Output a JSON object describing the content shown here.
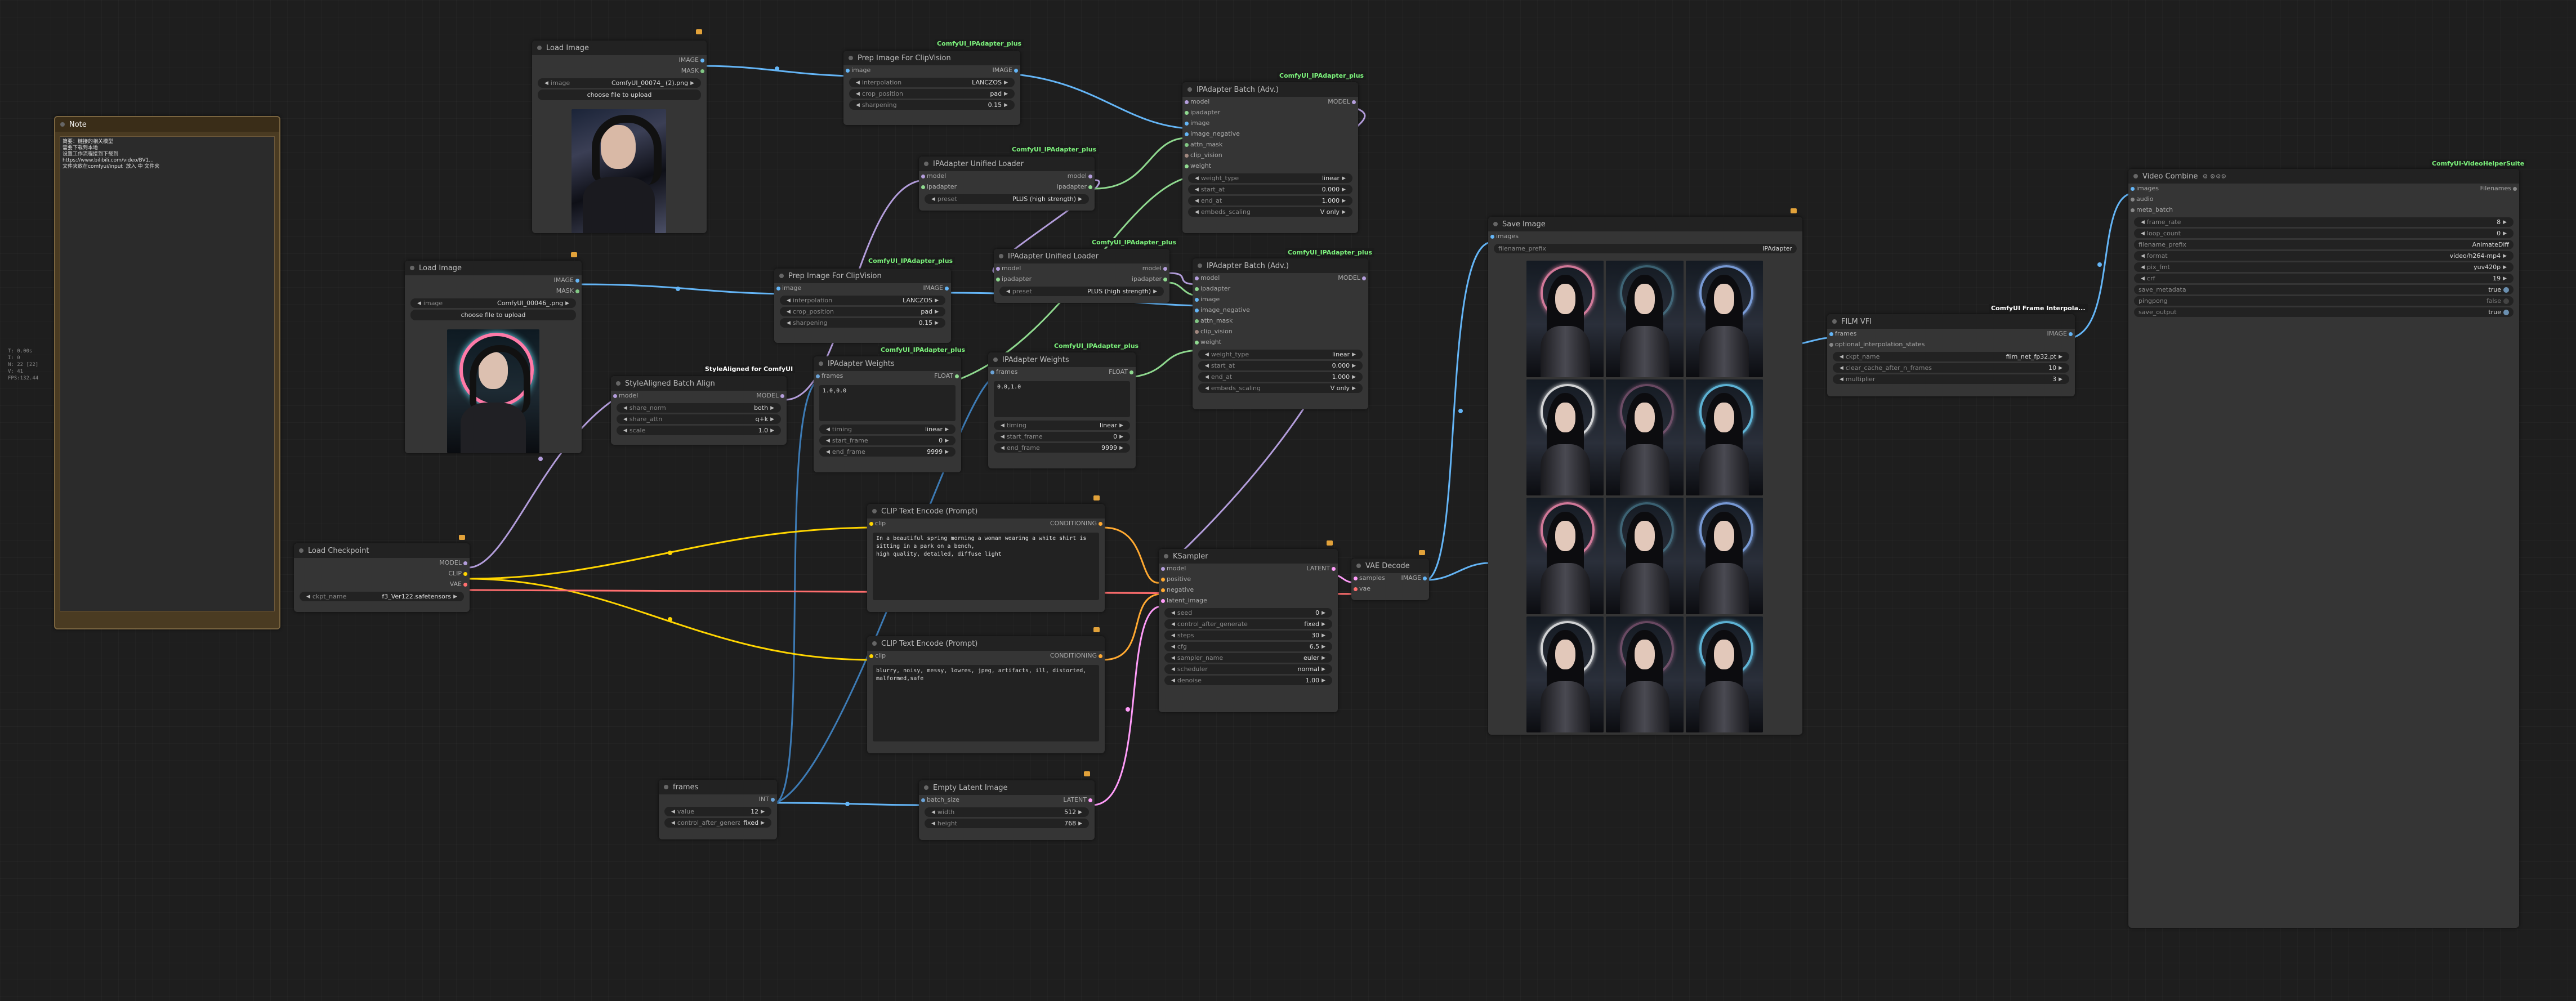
{
  "readout": [
    "T: 0.00s",
    "I: 0",
    "N: 22 [22]",
    "V: 41",
    "FPS:132.44"
  ],
  "note": {
    "title": "Note",
    "text": "简要：链接的相关模型\n需要下载到本地\n设置工作流程接到下载到\nhttps://www.bilibili.com/video/BV1...\n文件夹放在comfyui/input  放入 中 文件夹"
  },
  "nodes": {
    "load_image_1": {
      "title": "Load Image",
      "outputs": [
        "IMAGE",
        "MASK"
      ],
      "image": "ComfyUI_00074_ (2).png",
      "upload": "choose file to upload",
      "image_label": "image"
    },
    "load_image_2": {
      "title": "Load Image",
      "outputs": [
        "IMAGE",
        "MASK"
      ],
      "image": "ComfyUI_00046_.png",
      "upload": "choose file to upload",
      "image_label": "image"
    },
    "prep_1": {
      "title": "Prep Image For ClipVision",
      "tag": "ComfyUI_IPAdapter_plus",
      "input": "image",
      "output": "IMAGE",
      "widgets": [
        [
          "interpolation",
          "LANCZOS"
        ],
        [
          "crop_position",
          "pad"
        ],
        [
          "sharpening",
          "0.15"
        ]
      ]
    },
    "prep_2": {
      "title": "Prep Image For ClipVision",
      "tag": "ComfyUI_IPAdapter_plus",
      "input": "image",
      "output": "IMAGE",
      "widgets": [
        [
          "interpolation",
          "LANCZOS"
        ],
        [
          "crop_position",
          "pad"
        ],
        [
          "sharpening",
          "0.15"
        ]
      ]
    },
    "unified_1": {
      "title": "IPAdapter Unified Loader",
      "tag": "ComfyUI_IPAdapter_plus",
      "inputs": [
        "model",
        "ipadapter"
      ],
      "outputs": [
        "model",
        "ipadapter"
      ],
      "widgets": [
        [
          "preset",
          "PLUS (high strength)"
        ]
      ]
    },
    "unified_2": {
      "title": "IPAdapter Unified Loader",
      "tag": "ComfyUI_IPAdapter_plus",
      "inputs": [
        "model",
        "ipadapter"
      ],
      "outputs": [
        "model",
        "ipadapter"
      ],
      "widgets": [
        [
          "preset",
          "PLUS (high strength)"
        ]
      ]
    },
    "batch_1": {
      "title": "IPAdapter Batch (Adv.)",
      "tag": "ComfyUI_IPAdapter_plus",
      "output": "MODEL",
      "inputs": [
        "model",
        "ipadapter",
        "image",
        "image_negative",
        "attn_mask",
        "clip_vision",
        "weight"
      ],
      "widgets": [
        [
          "weight_type",
          "linear"
        ],
        [
          "start_at",
          "0.000"
        ],
        [
          "end_at",
          "1.000"
        ],
        [
          "embeds_scaling",
          "V only"
        ]
      ]
    },
    "batch_2": {
      "title": "IPAdapter Batch (Adv.)",
      "tag": "ComfyUI_IPAdapter_plus",
      "output": "MODEL",
      "inputs": [
        "model",
        "ipadapter",
        "image",
        "image_negative",
        "attn_mask",
        "clip_vision",
        "weight"
      ],
      "widgets": [
        [
          "weight_type",
          "linear"
        ],
        [
          "start_at",
          "0.000"
        ],
        [
          "end_at",
          "1.000"
        ],
        [
          "embeds_scaling",
          "V only"
        ]
      ]
    },
    "weights_1": {
      "title": "IPAdapter Weights",
      "tag": "ComfyUI_IPAdapter_plus",
      "input": "frames",
      "output": "FLOAT",
      "text": "1.0,0.0",
      "widgets": [
        [
          "timing",
          "linear"
        ],
        [
          "start_frame",
          "0"
        ],
        [
          "end_frame",
          "9999"
        ]
      ]
    },
    "weights_2": {
      "title": "IPAdapter Weights",
      "tag": "ComfyUI_IPAdapter_plus",
      "input": "frames",
      "output": "FLOAT",
      "text": "0.0,1.0",
      "widgets": [
        [
          "timing",
          "linear"
        ],
        [
          "start_frame",
          "0"
        ],
        [
          "end_frame",
          "9999"
        ]
      ]
    },
    "style": {
      "title": "StyleAligned Batch Align",
      "tag": "StyleAligned for ComfyUI",
      "input": "model",
      "output": "MODEL",
      "widgets": [
        [
          "share_norm",
          "both"
        ],
        [
          "share_attn",
          "q+k"
        ],
        [
          "scale",
          "1.0"
        ]
      ]
    },
    "checkpoint": {
      "title": "Load Checkpoint",
      "outputs": [
        "MODEL",
        "CLIP",
        "VAE"
      ],
      "widgets": [
        [
          "ckpt_name",
          "f3_Ver122.safetensors"
        ]
      ]
    },
    "clip_pos": {
      "title": "CLIP Text Encode (Prompt)",
      "input": "clip",
      "output": "CONDITIONING",
      "text": "In a beautiful spring morning a woman wearing a white shirt is sitting in a park on a bench,\nhigh quality, detailed, diffuse light"
    },
    "clip_neg": {
      "title": "CLIP Text Encode (Prompt)",
      "input": "clip",
      "output": "CONDITIONING",
      "text": "blurry, noisy, messy, lowres, jpeg, artifacts, ill, distorted, malformed,safe"
    },
    "frames": {
      "title": "frames",
      "output": "INT",
      "widgets": [
        [
          "value",
          "12"
        ],
        [
          "control_after_generate",
          "fixed"
        ]
      ]
    },
    "latent": {
      "title": "Empty Latent Image",
      "input": "batch_size",
      "output": "LATENT",
      "widgets": [
        [
          "width",
          "512"
        ],
        [
          "height",
          "768"
        ]
      ]
    },
    "ksampler": {
      "title": "KSampler",
      "output": "LATENT",
      "inputs": [
        "model",
        "positive",
        "negative",
        "latent_image"
      ],
      "widgets": [
        [
          "seed",
          "0"
        ],
        [
          "control_after_generate",
          "fixed"
        ],
        [
          "steps",
          "30"
        ],
        [
          "cfg",
          "6.5"
        ],
        [
          "sampler_name",
          "euler"
        ],
        [
          "scheduler",
          "normal"
        ],
        [
          "denoise",
          "1.00"
        ]
      ]
    },
    "vae_decode": {
      "title": "VAE Decode",
      "inputs": [
        "samples",
        "vae"
      ],
      "output": "IMAGE"
    },
    "save": {
      "title": "Save Image",
      "input": "images",
      "widgets": [
        [
          "filename_prefix",
          "IPAdapter"
        ]
      ]
    },
    "film": {
      "title": "FILM VFI",
      "tag": "ComfyUI Frame Interpola...",
      "inputs": [
        "frames",
        "optional_interpolation_states"
      ],
      "output": "IMAGE",
      "widgets": [
        [
          "ckpt_name",
          "film_net_fp32.pt"
        ],
        [
          "clear_cache_after_n_frames",
          "10"
        ],
        [
          "multiplier",
          "3"
        ]
      ]
    },
    "video": {
      "title": "Video Combine",
      "tag": "ComfyUI-VideoHelperSuite",
      "inputs": [
        "images",
        "audio",
        "meta_batch"
      ],
      "output": "Filenames",
      "widgets": [
        [
          "frame_rate",
          "8"
        ],
        [
          "loop_count",
          "0"
        ],
        [
          "filename_prefix",
          "AnimateDiff"
        ],
        [
          "format",
          "video/h264-mp4"
        ],
        [
          "pix_fmt",
          "yuv420p"
        ],
        [
          "crf",
          "19"
        ],
        [
          "save_metadata",
          "true"
        ],
        [
          "pingpong",
          "false"
        ],
        [
          "save_output",
          "true"
        ]
      ]
    }
  }
}
